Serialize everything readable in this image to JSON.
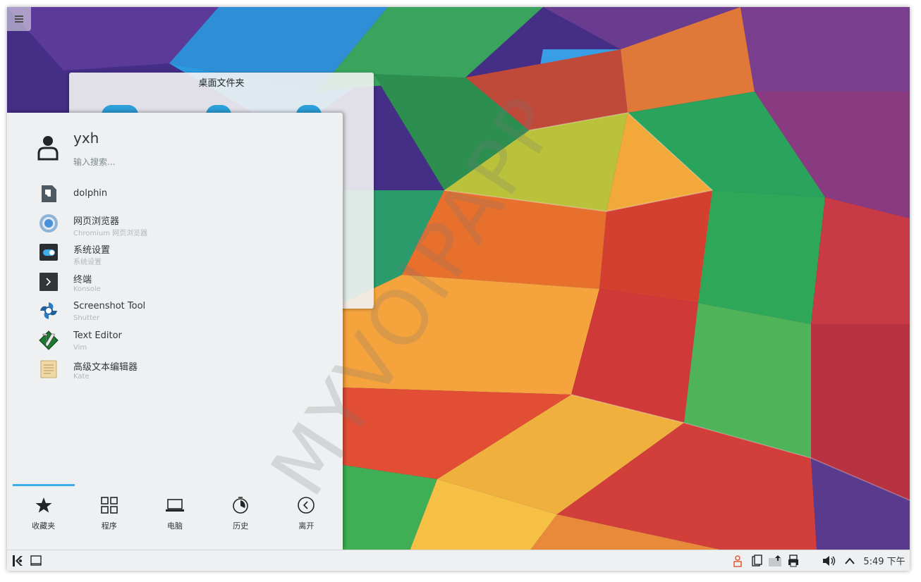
{
  "folder_widget": {
    "title": "桌面文件夹"
  },
  "launcher": {
    "username": "yxh",
    "search_placeholder": "输入搜索...",
    "favorites": [
      {
        "name": "dolphin",
        "subtitle": "",
        "icon": "file-manager-icon"
      },
      {
        "name": "网页浏览器",
        "subtitle": "Chromium 网页浏览器",
        "icon": "chromium-icon"
      },
      {
        "name": "系统设置",
        "subtitle": "系统设置",
        "icon": "system-settings-icon"
      },
      {
        "name": "终端",
        "subtitle": "Konsole",
        "icon": "terminal-icon"
      },
      {
        "name": "Screenshot Tool",
        "subtitle": "Shutter",
        "icon": "shutter-icon"
      },
      {
        "name": "Text Editor",
        "subtitle": "Vim",
        "icon": "vim-icon"
      },
      {
        "name": "高级文本编辑器",
        "subtitle": "Kate",
        "icon": "kate-icon"
      }
    ],
    "tabs": [
      {
        "label": "收藏夹",
        "icon": "star-icon",
        "active": true
      },
      {
        "label": "程序",
        "icon": "grid-icon",
        "active": false
      },
      {
        "label": "电脑",
        "icon": "laptop-icon",
        "active": false
      },
      {
        "label": "历史",
        "icon": "history-icon",
        "active": false
      },
      {
        "label": "离开",
        "icon": "leave-icon",
        "active": false
      }
    ]
  },
  "watermark": "MYVOIPAPP",
  "panel": {
    "clock": "5:49 下午"
  },
  "colors": {
    "accent": "#3daee9",
    "panel_bg": "#eff0f1",
    "text": "#31363b"
  }
}
